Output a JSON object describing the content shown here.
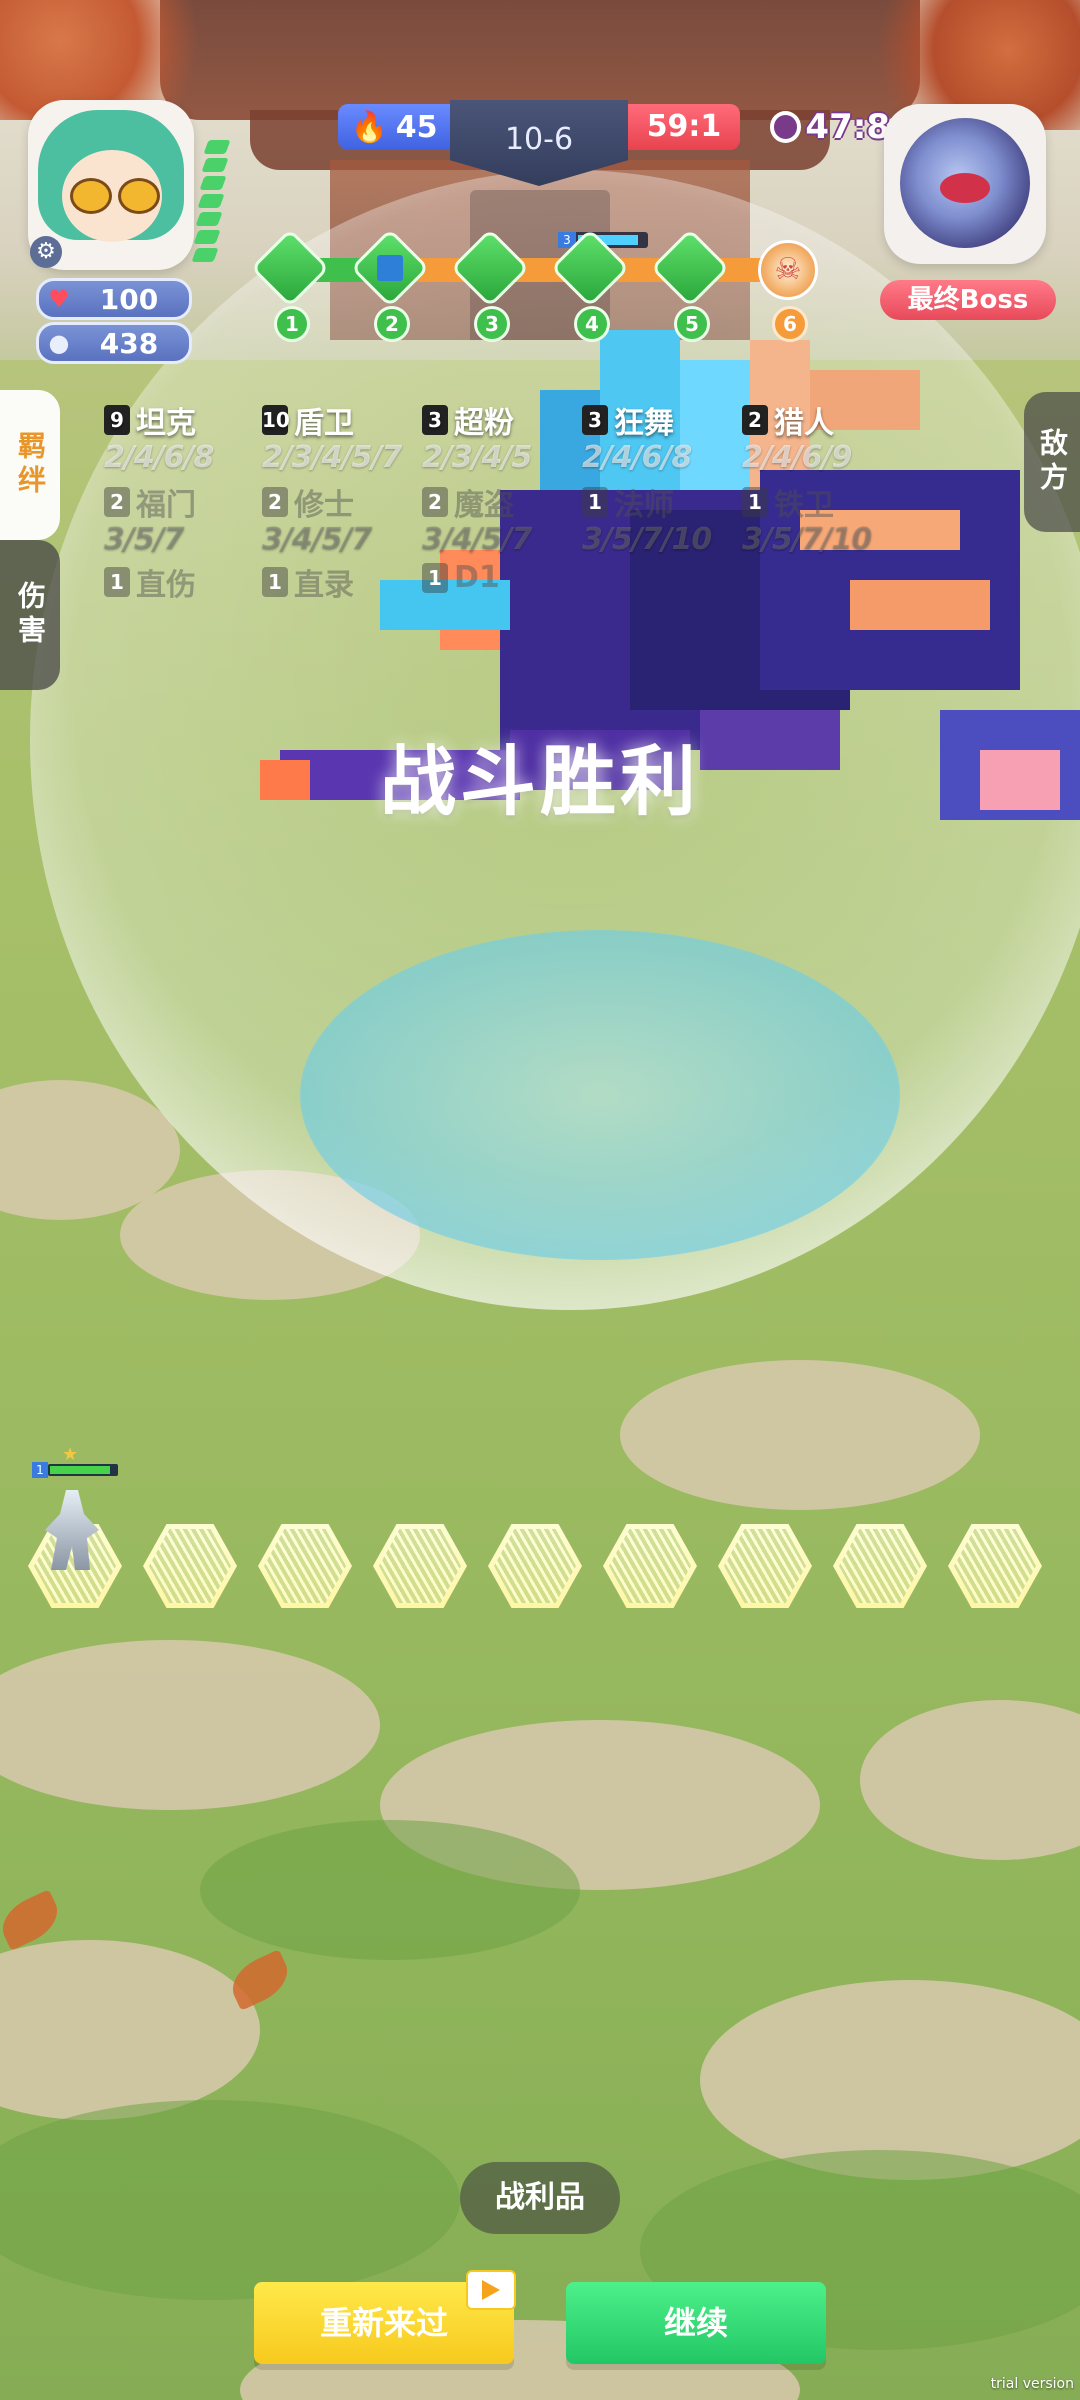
{
  "hud": {
    "player": {
      "hp": "100",
      "coins": "438",
      "hp_icon": "heart-icon",
      "coin_icon": "coin-stack-icon",
      "settings_icon": "gear-icon"
    },
    "gold": "45",
    "round": "10-6",
    "score": "59:1",
    "timer": "47:8",
    "boss_label": "最终Boss"
  },
  "stage_track": {
    "nodes": [
      "1",
      "2",
      "3",
      "4",
      "5",
      "6"
    ],
    "boss_node_icon": "skull-icon"
  },
  "side_tabs": {
    "bond": "羁绊",
    "damage": "伤害",
    "enemy": "敌方"
  },
  "synergies": [
    {
      "count": "9",
      "name": "坦克",
      "levels": "2/4/6/8",
      "active": true
    },
    {
      "count": "10",
      "name": "盾卫",
      "levels": "2/3/4/5/7",
      "active": true
    },
    {
      "count": "3",
      "name": "超粉",
      "levels": "2/3/4/5",
      "active": true
    },
    {
      "count": "3",
      "name": "狂舞",
      "levels": "2/4/6/8",
      "active": true
    },
    {
      "count": "2",
      "name": "猎人",
      "levels": "2/4/6/9",
      "active": true
    },
    {
      "count": "2",
      "name": "福门",
      "levels": "3/5/7",
      "active": false
    },
    {
      "count": "2",
      "name": "修士",
      "levels": "3/4/5/7",
      "active": false
    },
    {
      "count": "2",
      "name": "魔盗",
      "levels": "3/4/5/7",
      "active": false
    },
    {
      "count": "1",
      "name": "法师",
      "levels": "3/5/7/10",
      "active": false
    },
    {
      "count": "1",
      "name": "铁卫",
      "levels": "3/5/7/10",
      "active": false
    },
    {
      "count": "1",
      "name": "直伤",
      "levels": "",
      "active": false
    },
    {
      "count": "1",
      "name": "直录",
      "levels": "",
      "active": false
    },
    {
      "count": "1",
      "name": "D1",
      "levels": "",
      "active": false
    }
  ],
  "battle": {
    "result_text": "战斗胜利",
    "unit_level": "1"
  },
  "footer": {
    "loot_label": "战利品",
    "retry_label": "重新来过",
    "continue_label": "继续",
    "watermark": "trial version"
  },
  "colors": {
    "gold_pill": "#3f62e0",
    "score_pill": "#e8434f",
    "retry_button": "#f7c91d",
    "continue_button": "#22c765",
    "track_done": "#3fbf4c",
    "track_pending": "#f59b3a"
  }
}
